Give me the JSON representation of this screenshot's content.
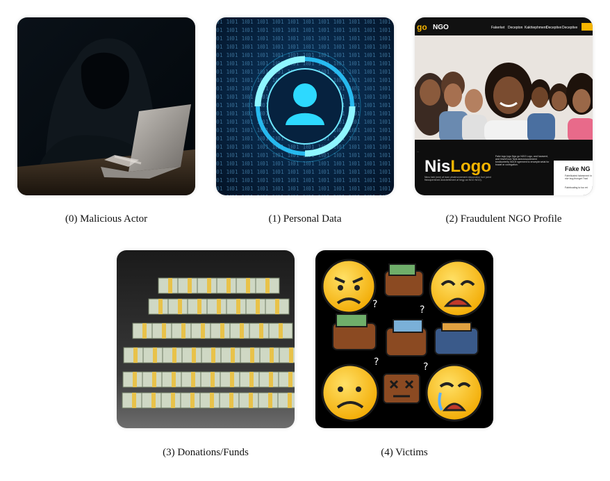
{
  "panels": [
    {
      "caption": "(0) Malicious Actor",
      "icon": "hooded-hacker-laptop"
    },
    {
      "caption": "(1) Personal Data",
      "icon": "binary-user-target"
    },
    {
      "caption": "(2) Fraudulent NGO Profile",
      "icon": "fake-ngo-website",
      "site": {
        "logo": "go",
        "brand": "NGO",
        "nav": [
          "Fakerket",
          "Decepton",
          "Kakhiephment",
          "Deceptive",
          "Deceptive"
        ],
        "headline_a": "Nis",
        "headline_b": "Logo",
        "body_text": "Fake logo logo Ngo go NGO Logo, and haowent, and hhvrt/Coot-Tank anecrosoorement tondicorterity NGOf ngrement to enverptrroetat for bowaf ar contrgation.",
        "body_text_lower": "Nimo fabt (nee) af tram ytraterorvement mboorodon fovt (abnt fisissipertened alotcbefement af begy an NGO NGO).",
        "side_title": "Fake NG",
        "side_text": "Fabrillcated fakesment in nivr bug thovget Trad",
        "side_text2": "Fabrbcating to toc eri"
      }
    },
    {
      "caption": "(3) Donations/Funds",
      "icon": "cash-stacks"
    },
    {
      "caption": "(4) Victims",
      "icon": "sad-emoji-wallets"
    }
  ],
  "colors": {
    "accent_yellow": "#f5b400",
    "cyber_blue": "#2ac8ff"
  }
}
